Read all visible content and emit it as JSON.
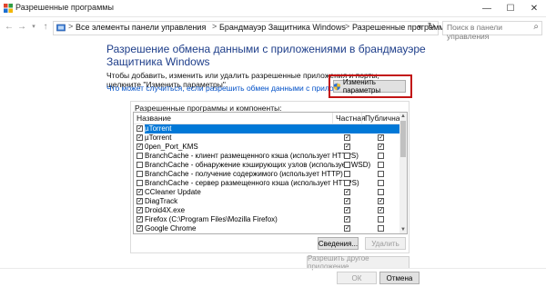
{
  "window": {
    "title": "Разрешенные программы",
    "controls": [
      "—",
      "☐",
      "✕"
    ]
  },
  "address": {
    "crumbs": [
      "Все элементы панели управления",
      "Брандмауэр Защитника Windows",
      "Разрешенные программы"
    ],
    "separator": ">",
    "search_placeholder": "Поиск в панели управления"
  },
  "page": {
    "heading": "Разрешение обмена данными с приложениями в брандмауэре Защитника Windows",
    "description": "Чтобы добавить, изменить или удалить разрешенные приложения и порты, щелкните \"Изменить параметры\".",
    "risk_link": "Что может случиться, если разрешить обмен данными с приложением?",
    "change_button": "Изменить параметры"
  },
  "apps_group": {
    "label": "Разрешенные программы и компоненты:",
    "columns": {
      "name": "Название",
      "private": "Частная",
      "public": "Публичная"
    },
    "rows": [
      {
        "name": "µTorrent",
        "enabled": true,
        "private": null,
        "public": null,
        "selected": true
      },
      {
        "name": "µTorrent",
        "enabled": true,
        "private": true,
        "public": true
      },
      {
        "name": "0pen_Port_KMS",
        "enabled": true,
        "private": true,
        "public": true
      },
      {
        "name": "BranchCache - клиент размещенного кэша (использует HTTPS)",
        "enabled": false,
        "private": false,
        "public": false
      },
      {
        "name": "BranchCache - обнаружение кэширующих узлов (использует WSD)",
        "enabled": false,
        "private": false,
        "public": false
      },
      {
        "name": "BranchCache - получение содержимого (использует HTTP)",
        "enabled": false,
        "private": false,
        "public": false
      },
      {
        "name": "BranchCache - сервер размещенного кэша (использует HTTPS)",
        "enabled": false,
        "private": false,
        "public": false
      },
      {
        "name": "CCleaner Update",
        "enabled": true,
        "private": true,
        "public": false
      },
      {
        "name": "DiagTrack",
        "enabled": true,
        "private": true,
        "public": true
      },
      {
        "name": "Droid4X.exe",
        "enabled": true,
        "private": true,
        "public": true
      },
      {
        "name": "Firefox (C:\\Program Files\\Mozilla Firefox)",
        "enabled": true,
        "private": true,
        "public": false
      },
      {
        "name": "Google Chrome",
        "enabled": true,
        "private": true,
        "public": false
      }
    ],
    "details_button": "Сведения...",
    "delete_button": "Удалить"
  },
  "allow_other_button": "Разрешить другое приложение...",
  "ok_button": "ОК",
  "cancel_button": "Отмена",
  "colors": {
    "heading": "#1e3e8a",
    "link": "#0050c8",
    "selection": "#0078d7",
    "highlight_box": "#c21414"
  }
}
